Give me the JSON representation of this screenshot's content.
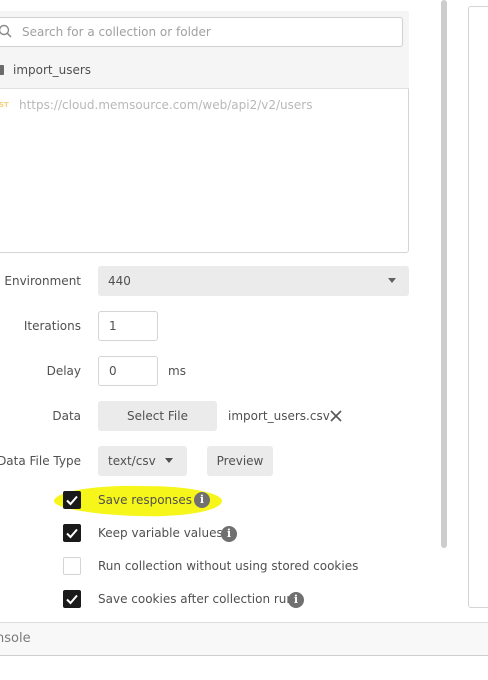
{
  "collection": {
    "search_placeholder": "Search for a collection or folder",
    "name": "import_users",
    "request": {
      "method": "POST",
      "method_visible": "ST",
      "url": "https://cloud.memsource.com/web/api2/v2/users"
    }
  },
  "form": {
    "environment": {
      "label": "Environment",
      "value": "440"
    },
    "iterations": {
      "label": "Iterations",
      "value": "1"
    },
    "delay": {
      "label": "Delay",
      "value": "0",
      "unit": "ms"
    },
    "data": {
      "label": "Data",
      "button_label": "Select File",
      "file_name": "import_users.csv"
    },
    "data_file_type": {
      "label": "Data File Type",
      "value": "text/csv",
      "preview_label": "Preview"
    }
  },
  "options": [
    {
      "label": "Save responses",
      "checked": true,
      "info": true,
      "highlighted": true
    },
    {
      "label": "Keep variable values",
      "checked": true,
      "info": true
    },
    {
      "label": "Run collection without using stored cookies",
      "checked": false,
      "info": false
    },
    {
      "label": "Save cookies after collection run",
      "checked": true,
      "info": true
    }
  ],
  "footer": {
    "console_label": "nsole"
  },
  "colors": {
    "highlight": "#f6f61a",
    "checkbox_checked": "#1a1a1a",
    "method_post": "#f5d17a"
  }
}
